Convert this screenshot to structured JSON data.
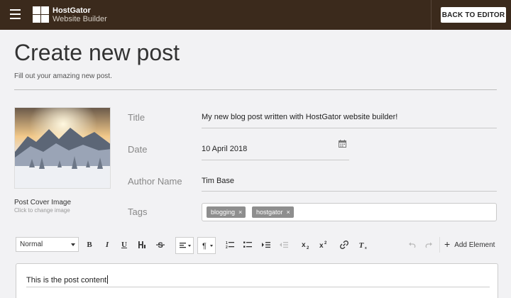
{
  "topbar": {
    "brand_name": "HostGator",
    "brand_sub": "Website Builder",
    "back_button": "BACK TO EDITOR",
    "bg_color": "#3b2a1c"
  },
  "header": {
    "title": "Create new post",
    "subtitle": "Fill out your amazing new post."
  },
  "cover": {
    "label": "Post Cover Image",
    "hint": "Click to change image"
  },
  "form": {
    "title_label": "Title",
    "title_value": "My new blog post written with HostGator website builder!",
    "date_label": "Date",
    "date_value": "10 April 2018",
    "author_label": "Author Name",
    "author_value": "Tim Base",
    "tags_label": "Tags",
    "tags": [
      "blogging",
      "hostgator"
    ],
    "tag_remove": "×"
  },
  "toolbar": {
    "block_format": "Normal",
    "bold": "B",
    "italic": "I",
    "underline": "U",
    "add_element": "Add Element"
  },
  "editor": {
    "content": "This is the post content"
  }
}
